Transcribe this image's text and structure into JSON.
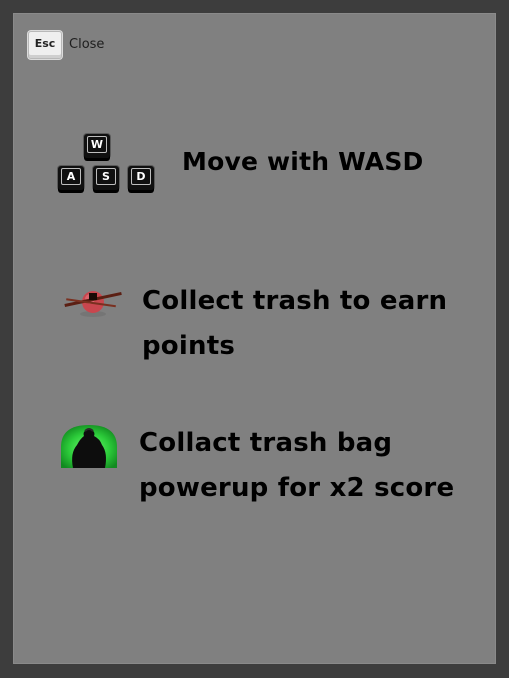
{
  "close": {
    "key_label": "Esc",
    "label": "Close"
  },
  "keys": {
    "w": "W",
    "a": "A",
    "s": "S",
    "d": "D"
  },
  "instructions": {
    "move": "Move with WASD",
    "collect": "Collect trash to earn points",
    "powerup": "Collact trash bag powerup for x2 score"
  },
  "icons": {
    "wasd": "wasd-keys-icon",
    "trash": "trash-item-icon",
    "bag": "trash-bag-powerup-icon"
  },
  "colors": {
    "background": "#3d3d3d",
    "panel": "#808080",
    "text": "#000000",
    "powerup_glow": "#33cc44"
  }
}
